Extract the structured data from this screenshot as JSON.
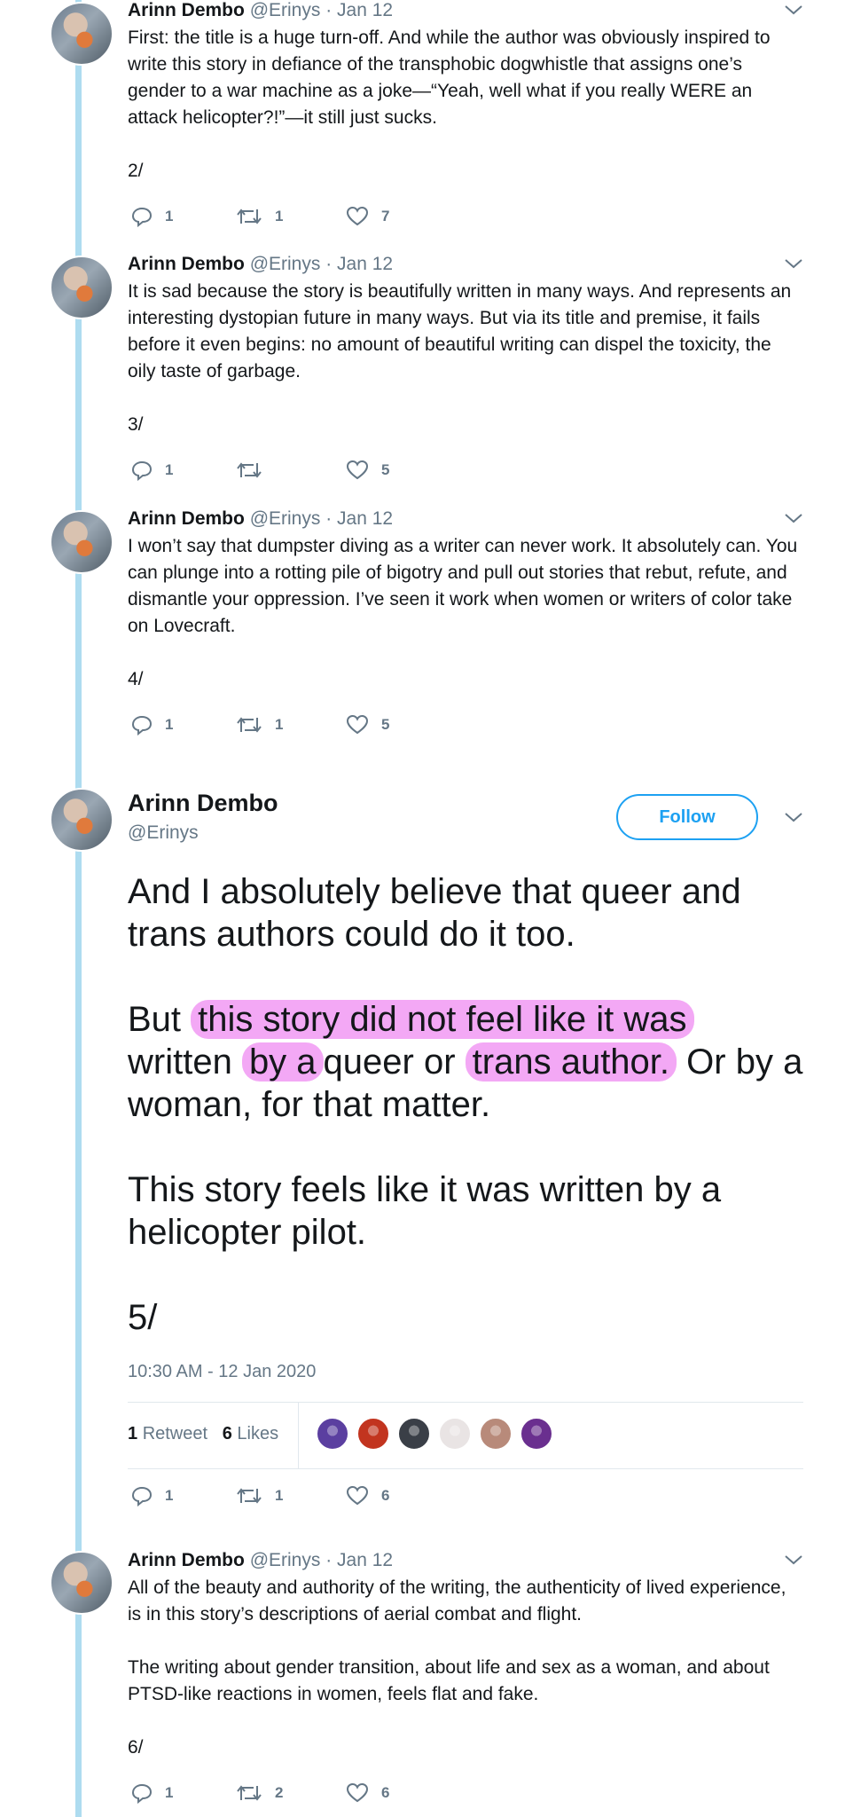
{
  "author": {
    "name": "Arinn Dembo",
    "handle": "@Erinys",
    "date": "· Jan 12"
  },
  "tweets": [
    {
      "paragraphs": [
        "First: the title is a huge turn-off. And while the author was obviously inspired to write this story in defiance of the transphobic dogwhistle that assigns one’s gender to a war machine as a joke—“Yeah, well what if you really WERE an attack helicopter?!”—it still just sucks."
      ],
      "number": "2/",
      "replies": "1",
      "retweets": "1",
      "likes": "7"
    },
    {
      "paragraphs": [
        "It is sad because the story is beautifully written in many ways. And represents an interesting dystopian future in many ways. But via its title and premise, it fails before it even begins: no amount of beautiful writing can dispel the toxicity, the oily taste of garbage."
      ],
      "number": "3/",
      "replies": "1",
      "retweets": "",
      "likes": "5"
    },
    {
      "paragraphs": [
        "I won’t say that dumpster diving as a writer can never work. It absolutely can. You can plunge into a rotting pile of bigotry and pull out stories that rebut, refute, and dismantle your oppression. I’ve seen it work when women or writers of color take on Lovecraft."
      ],
      "number": "4/",
      "replies": "1",
      "retweets": "1",
      "likes": "5"
    }
  ],
  "main_tweet": {
    "follow_label": "Follow",
    "p1": "And I absolutely believe that queer and trans authors could do it too.",
    "p2_a": "But",
    "p2_h1": "this story did not feel like it was",
    "p2_b": "written",
    "p2_h2": "by a",
    "p2_c": "queer or",
    "p2_h3": "trans author.",
    "p2_d": "Or by a woman, for that matter.",
    "p3": "This story feels like it was written by a helicopter pilot.",
    "number": "5/",
    "timestamp": "10:30 AM - 12 Jan 2020",
    "retweet_count": "1",
    "retweet_label": "Retweet",
    "like_count": "6",
    "like_label": "Likes",
    "liker_colors": [
      "#5b3fa0",
      "#c2341f",
      "#3a3f47",
      "#e9e4e4",
      "#b88a7a",
      "#6a2f8f"
    ],
    "replies": "1",
    "retweets": "1",
    "likes": "6"
  },
  "last_tweet": {
    "p1": "All of the beauty and authority of the writing, the authenticity of lived experience, is in this story’s descriptions of aerial combat and flight.",
    "p2": "The writing about gender transition, about life and sex as a woman, and about PTSD-like reactions in women, feels flat and fake.",
    "number": "6/",
    "replies": "1",
    "retweets": "2",
    "likes": "6"
  },
  "colors": {
    "thread_line": "#aedcf0",
    "highlight": "#f3a8f5",
    "accent": "#1da1f2"
  }
}
